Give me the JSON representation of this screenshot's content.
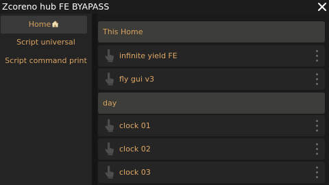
{
  "window": {
    "title": "Zcoreno hub FE BYAPASS"
  },
  "sidebar": {
    "items": [
      {
        "label": "Home"
      },
      {
        "label": "Script universal"
      },
      {
        "label": "Script command print"
      }
    ]
  },
  "main": {
    "sections": [
      {
        "label": "This Home",
        "rows": [
          {
            "label": "infinite yield FE",
            "icon": "tap-icon"
          },
          {
            "label": "fly gui v3",
            "icon": "tap-icon"
          }
        ]
      },
      {
        "label": "day",
        "rows": [
          {
            "label": "clock 01",
            "icon": "tap-icon"
          },
          {
            "label": "clock 02",
            "icon": "tap-icon"
          },
          {
            "label": "clock 03",
            "icon": "tap-icon"
          }
        ]
      }
    ]
  },
  "colors": {
    "accent_text": "#d8a260",
    "row_background": "#252525",
    "section_background": "#3c3c38",
    "sidebar_background": "#242424"
  }
}
